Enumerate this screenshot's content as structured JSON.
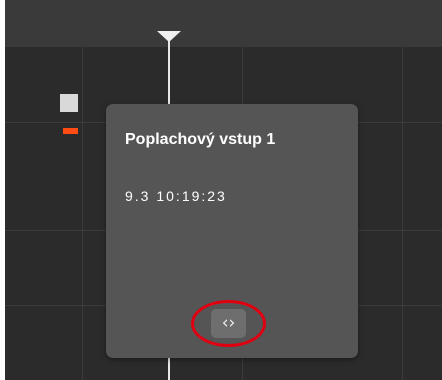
{
  "tooltip": {
    "title": "Poplachový vstup 1",
    "time": "9.3 10:19:23"
  },
  "expand_button": {
    "icon": "code-expand-icon",
    "glyph": "‹›"
  },
  "colors": {
    "event_mark": "#ff4b14",
    "highlight_ring": "#e00010",
    "playhead": "#f0f0f0"
  }
}
